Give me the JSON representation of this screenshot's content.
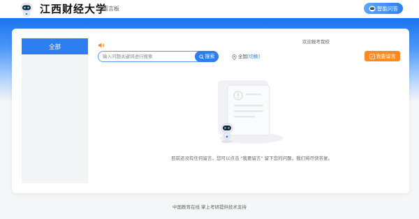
{
  "header": {
    "school_name": "江西财经大学",
    "board_label": "留言板",
    "ai_button_label": "智能问答"
  },
  "sidebar": {
    "items": [
      {
        "label": "全部",
        "active": true
      }
    ]
  },
  "main": {
    "welcome_text": "欢迎报考我校",
    "search": {
      "placeholder": "输入问题关键词进行搜索",
      "value": "",
      "button_label": "搜索"
    },
    "region": {
      "label": "全国",
      "switch_label": "[切换]"
    },
    "leave_message_label": "我要留言",
    "empty_text": "目前还没有任何留言，您可以点击 \"我要留言\" 留下您的问题，我们将尽快答复。"
  },
  "footer": {
    "text": "中国教育在线 掌上考研提供技术支持"
  },
  "colors": {
    "primary": "#2d7ff0",
    "accent_orange": "#ff8a1f",
    "hero_top": "#1c73f0",
    "background": "#f5f6f8"
  },
  "icons": {
    "logo": "robot-mascot-icon",
    "ai": "robot-head-icon",
    "notice": "speaker-icon",
    "search": "search-icon",
    "region": "location-pin-icon",
    "leave_message": "edit-icon"
  }
}
